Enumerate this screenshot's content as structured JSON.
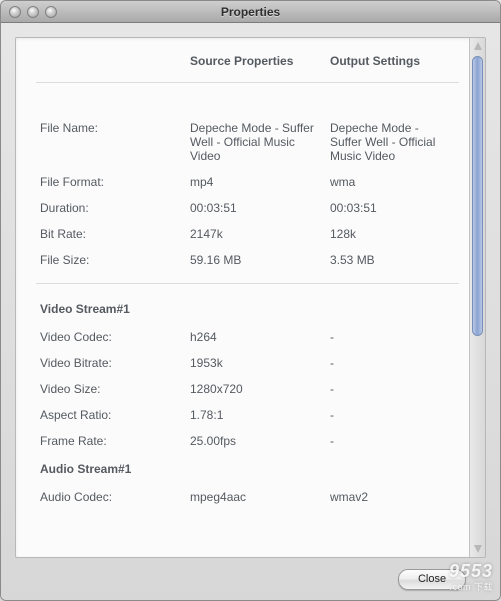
{
  "window": {
    "title": "Properties"
  },
  "columns": {
    "source": "Source Properties",
    "output": "Output Settings"
  },
  "general": {
    "rows": [
      {
        "label": "File Name:",
        "src": "Depeche Mode - Suffer Well - Official Music Video",
        "out": "Depeche Mode - Suffer Well - Official Music Video"
      },
      {
        "label": "File Format:",
        "src": "mp4",
        "out": "wma"
      },
      {
        "label": "Duration:",
        "src": "00:03:51",
        "out": "00:03:51"
      },
      {
        "label": "Bit Rate:",
        "src": "2147k",
        "out": "128k"
      },
      {
        "label": "File Size:",
        "src": "59.16 MB",
        "out": "3.53 MB"
      }
    ]
  },
  "video": {
    "heading": "Video Stream#1",
    "rows": [
      {
        "label": "Video Codec:",
        "src": "h264",
        "out": "-"
      },
      {
        "label": "Video Bitrate:",
        "src": "1953k",
        "out": "-"
      },
      {
        "label": "Video Size:",
        "src": "1280x720",
        "out": "-"
      },
      {
        "label": "Aspect Ratio:",
        "src": "1.78:1",
        "out": "-"
      },
      {
        "label": "Frame Rate:",
        "src": "25.00fps",
        "out": "-"
      }
    ]
  },
  "audio": {
    "heading": "Audio Stream#1",
    "rows": [
      {
        "label": "Audio Codec:",
        "src": "mpeg4aac",
        "out": "wmav2"
      }
    ]
  },
  "buttons": {
    "close": "Close"
  },
  "watermark": {
    "brand": "9553",
    "sub": ".com 下载"
  }
}
